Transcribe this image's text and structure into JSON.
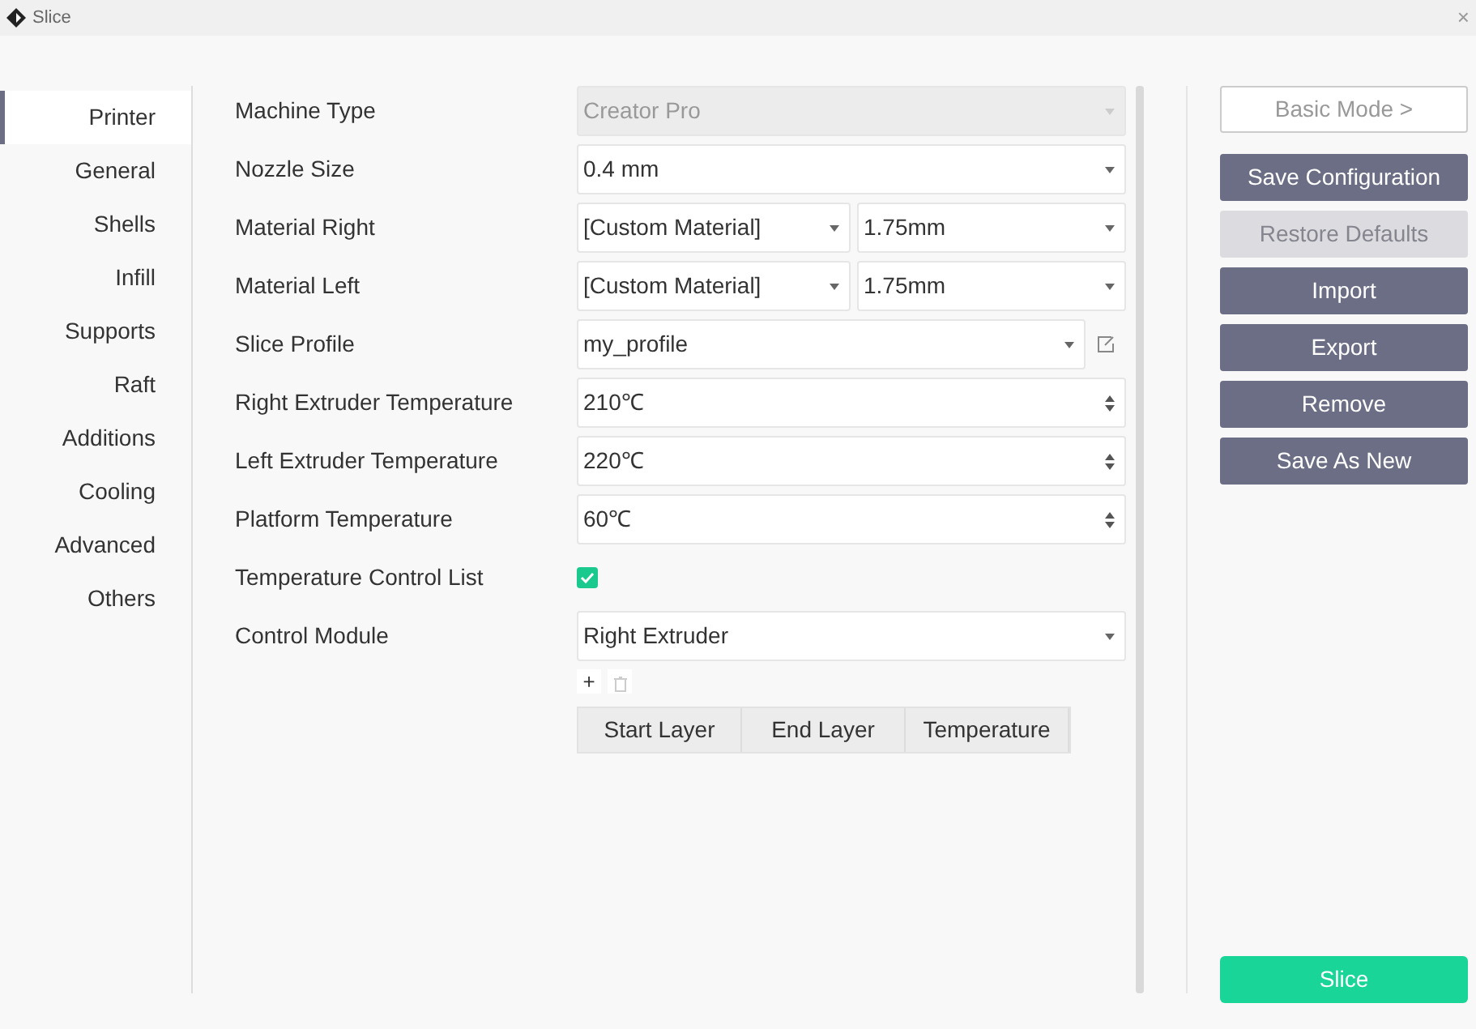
{
  "window": {
    "title": "Slice",
    "close": "×"
  },
  "sidebar": {
    "items": [
      {
        "label": "Printer",
        "selected": true
      },
      {
        "label": "General",
        "selected": false
      },
      {
        "label": "Shells",
        "selected": false
      },
      {
        "label": "Infill",
        "selected": false
      },
      {
        "label": "Supports",
        "selected": false
      },
      {
        "label": "Raft",
        "selected": false
      },
      {
        "label": "Additions",
        "selected": false
      },
      {
        "label": "Cooling",
        "selected": false
      },
      {
        "label": "Advanced",
        "selected": false
      },
      {
        "label": "Others",
        "selected": false
      }
    ]
  },
  "settings": [
    {
      "kind": "select",
      "label": "Machine Type",
      "value": "Creator Pro",
      "disabled": true
    },
    {
      "kind": "select",
      "label": "Nozzle Size",
      "value": "0.4 mm",
      "disabled": false
    },
    {
      "kind": "pair",
      "label": "Material Right",
      "value": "[Custom Material]",
      "value_2": "1.75mm"
    },
    {
      "kind": "pair",
      "label": "Material Left",
      "value": "[Custom Material]",
      "value_2": "1.75mm"
    },
    {
      "kind": "profile",
      "label": "Slice Profile",
      "value": "my_profile"
    },
    {
      "kind": "spin",
      "label": "Right Extruder Temperature",
      "value": "210℃"
    },
    {
      "kind": "spin",
      "label": "Left Extruder Temperature",
      "value": "220℃"
    },
    {
      "kind": "spin",
      "label": "Platform Temperature",
      "value": "60℃"
    },
    {
      "kind": "checkbox",
      "label": "Temperature Control List",
      "checked": true
    },
    {
      "kind": "select",
      "label": "Control Module",
      "value": "Right Extruder",
      "disabled": false
    }
  ],
  "list_tools": {
    "add": "+",
    "delete_disabled": true
  },
  "table": {
    "columns": [
      "Start Layer",
      "End Layer",
      "Temperature"
    ]
  },
  "actions": [
    {
      "label": "Basic Mode >",
      "kind": "outline",
      "disabled": false
    },
    {
      "label": "Save Configuration",
      "kind": "dark",
      "disabled": false
    },
    {
      "label": "Restore Defaults",
      "kind": "dark",
      "disabled": true
    },
    {
      "label": "Import",
      "kind": "dark",
      "disabled": false
    },
    {
      "label": "Export",
      "kind": "dark",
      "disabled": false
    },
    {
      "label": "Remove",
      "kind": "dark",
      "disabled": false
    },
    {
      "label": "Save As New",
      "kind": "dark",
      "disabled": false
    }
  ],
  "slice_button": "Slice"
}
